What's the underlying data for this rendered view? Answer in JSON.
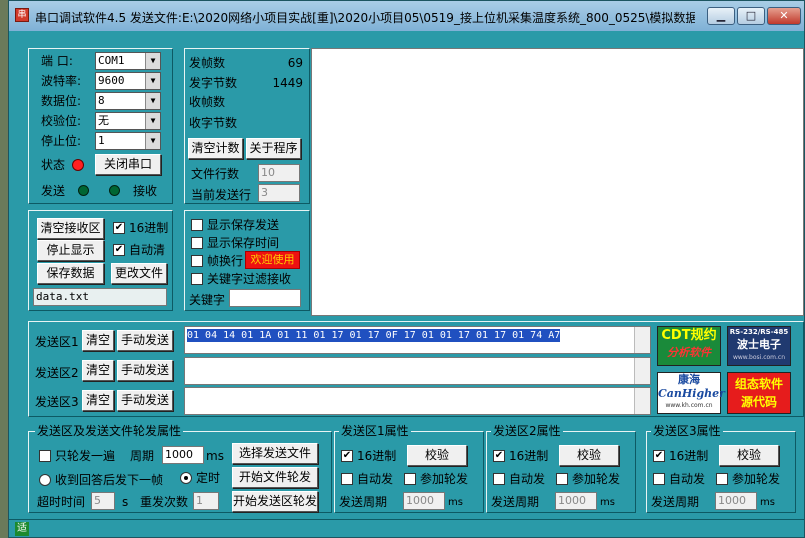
{
  "window": {
    "title": "串口调试软件4.5 发送文件:E:\\2020网络小项目实战[重]\\2020小项目05\\0519_接上位机采集温度系统_800_0525\\模拟数据...",
    "app_icon": "串",
    "controls": {
      "minimize": "▁",
      "maximize": "□",
      "close": "✕"
    }
  },
  "serial": {
    "port_label": "端  口:",
    "port_value": "COM1",
    "baud_label": "波特率:",
    "baud_value": "9600",
    "databits_label": "数据位:",
    "databits_value": "8",
    "parity_label": "校验位:",
    "parity_value": "无",
    "stopbits_label": "停止位:",
    "stopbits_value": "1",
    "status_label": "状态",
    "status_color": "#ff2020",
    "close_port_button": "关闭串口",
    "send_label": "发送",
    "recv_label": "接收"
  },
  "stats": {
    "sent_frames_label": "发帧数",
    "sent_frames": "69",
    "sent_bytes_label": "发字节数",
    "sent_bytes": "1449",
    "recv_frames_label": "收帧数",
    "recv_bytes_label": "收字节数",
    "clear_count_button": "清空计数",
    "about_button": "关于程序",
    "file_lines_label": "文件行数",
    "file_lines": "10",
    "current_line_label": "当前发送行",
    "current_line": "3"
  },
  "recv_controls": {
    "clear_button": "清空接收区",
    "hex_label": "16进制",
    "hex_checked": true,
    "stop_display_button": "停止显示",
    "auto_clear_label": "自动清",
    "auto_clear_checked": true,
    "save_data_button": "保存数据",
    "change_file_button": "更改文件",
    "filename": "data.txt"
  },
  "display_options": {
    "show_saved_send": "显示保存发送",
    "show_saved_time": "显示保存时间",
    "line_wrap": "帧换行",
    "welcome_badge": "欢迎使用",
    "keyword_filter": "关键字过滤接收",
    "keyword_label": "关键字",
    "keyword_value": ""
  },
  "send_areas": [
    {
      "label": "发送区1",
      "clear": "清空",
      "manual": "手动发送",
      "content": "01 04 14 01 1A 01 11 01 17 01 17 0F 17 01 01 17 01 17 01 74 A7"
    },
    {
      "label": "发送区2",
      "clear": "清空",
      "manual": "手动发送",
      "content": ""
    },
    {
      "label": "发送区3",
      "clear": "清空",
      "manual": "手动发送",
      "content": ""
    }
  ],
  "logos": {
    "cdt_line1": "CDT规约",
    "cdt_line2": "分析软件",
    "bosi_line1": "RS-232/RS-485",
    "bosi_line2": "波士电子",
    "bosi_line3": "www.bosi.com.cn",
    "kanghai_line1": "康海",
    "kanghai_line2": "CanHigher",
    "kanghai_line3": "www.kh.com.cn",
    "config_line1": "组态软件",
    "config_line2": "源代码"
  },
  "rotation": {
    "group_title": "发送区及发送文件轮发属性",
    "send_once_label": "只轮发一遍",
    "period_label": "周期",
    "period_value": "1000",
    "period_unit": "ms",
    "reply_label": "收到回答后发下一帧",
    "timed_label": "定时",
    "timeout_label": "超时时间",
    "timeout_value": "5",
    "timeout_unit": "s",
    "repeat_label": "重发次数",
    "repeat_value": "1",
    "select_file_button": "选择发送文件",
    "start_file_button": "开始文件轮发",
    "start_area_button": "开始发送区轮发"
  },
  "area_props": [
    {
      "title": "发送区1属性",
      "hex": "16进制",
      "verify": "校验",
      "auto": "自动发",
      "join": "参加轮发",
      "period_label": "发送周期",
      "period": "1000",
      "unit": "ms"
    },
    {
      "title": "发送区2属性",
      "hex": "16进制",
      "verify": "校验",
      "auto": "自动发",
      "join": "参加轮发",
      "period_label": "发送周期",
      "period": "1000",
      "unit": "ms"
    },
    {
      "title": "发送区3属性",
      "hex": "16进制",
      "verify": "校验",
      "auto": "自动发",
      "join": "参加轮发",
      "period_label": "发送周期",
      "period": "1000",
      "unit": "ms"
    }
  ],
  "statusbar": {
    "icon_text": "适"
  }
}
